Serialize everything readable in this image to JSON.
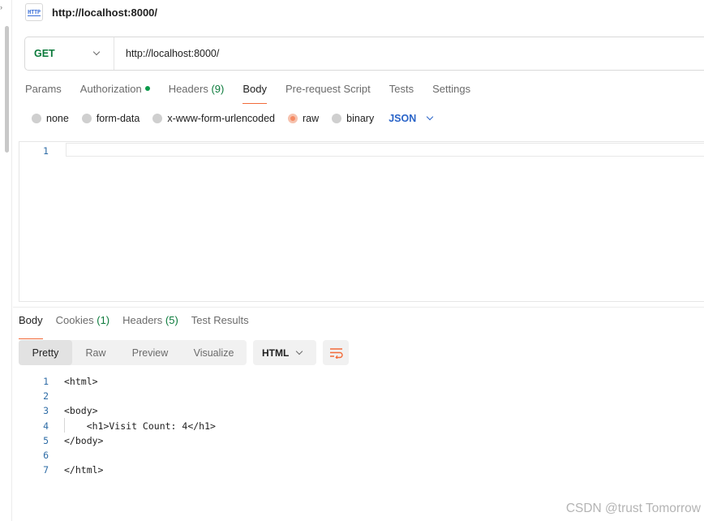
{
  "header": {
    "icon_label": "HTTP",
    "title": "http://localhost:8000/"
  },
  "request": {
    "method": "GET",
    "url": "http://localhost:8000/"
  },
  "request_tabs": [
    {
      "label": "Params"
    },
    {
      "label": "Authorization"
    },
    {
      "label": "Headers",
      "count": "(9)"
    },
    {
      "label": "Body"
    },
    {
      "label": "Pre-request Script"
    },
    {
      "label": "Tests"
    },
    {
      "label": "Settings"
    }
  ],
  "body_types": [
    {
      "label": "none"
    },
    {
      "label": "form-data"
    },
    {
      "label": "x-www-form-urlencoded"
    },
    {
      "label": "raw"
    },
    {
      "label": "binary"
    }
  ],
  "body_language": "JSON",
  "request_editor": {
    "line_number": "1",
    "content": ""
  },
  "response_tabs": [
    {
      "label": "Body"
    },
    {
      "label": "Cookies",
      "count": "(1)"
    },
    {
      "label": "Headers",
      "count": "(5)"
    },
    {
      "label": "Test Results"
    }
  ],
  "view_modes": [
    "Pretty",
    "Raw",
    "Preview",
    "Visualize"
  ],
  "response_format": "HTML",
  "response_code": [
    {
      "n": "1",
      "text": "<html>"
    },
    {
      "n": "2",
      "text": ""
    },
    {
      "n": "3",
      "text": "<body>"
    },
    {
      "n": "4",
      "text": "    <h1>Visit Count: 4</h1>"
    },
    {
      "n": "5",
      "text": "</body>"
    },
    {
      "n": "6",
      "text": ""
    },
    {
      "n": "7",
      "text": "</html>"
    }
  ],
  "watermark": "CSDN @trust Tomorrow",
  "colors": {
    "accent": "#f26b3a",
    "method_get": "#0b7a3b",
    "link_blue": "#2a64c8",
    "line_number": "#2e6ca6"
  }
}
